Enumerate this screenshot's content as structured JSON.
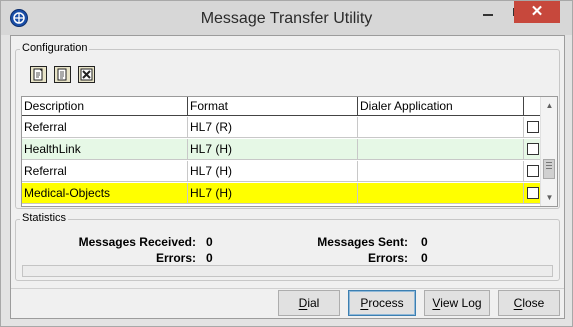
{
  "window": {
    "title": "Message Transfer Utility",
    "close_glyph": "✕"
  },
  "configuration": {
    "group_label": "Configuration",
    "toolbar_icons": [
      "new-record-icon",
      "edit-record-icon",
      "delete-record-icon"
    ],
    "columns": [
      "Description",
      "Format",
      "Dialer Application"
    ],
    "rows": [
      {
        "description": "Referral",
        "format": "HL7 (R)",
        "dialer": "",
        "checked": false,
        "highlight": "#ffffff"
      },
      {
        "description": "HealthLink",
        "format": "HL7 (H)",
        "dialer": "",
        "checked": false,
        "highlight": "#e6f8e6"
      },
      {
        "description": "Referral",
        "format": "HL7 (H)",
        "dialer": "",
        "checked": false,
        "highlight": "#ffffff"
      },
      {
        "description": "Medical-Objects",
        "format": "HL7 (H)",
        "dialer": "",
        "checked": false,
        "highlight": "#ffff00"
      }
    ]
  },
  "statistics": {
    "group_label": "Statistics",
    "messages_received_label": "Messages Received:",
    "messages_received_value": "0",
    "errors_left_label": "Errors:",
    "errors_left_value": "0",
    "messages_sent_label": "Messages Sent:",
    "messages_sent_value": "0",
    "errors_right_label": "Errors:",
    "errors_right_value": "0"
  },
  "buttons": {
    "dial": {
      "mnemonic": "D",
      "rest": "ial"
    },
    "process": {
      "mnemonic": "P",
      "rest": "rocess"
    },
    "view_log": {
      "mnemonic": "V",
      "rest": "iew Log"
    },
    "close": {
      "mnemonic": "C",
      "rest": "lose"
    }
  },
  "colors": {
    "selected_row": "#ffff00",
    "alt_row": "#e6f8e6",
    "close_button": "#c7483c"
  }
}
